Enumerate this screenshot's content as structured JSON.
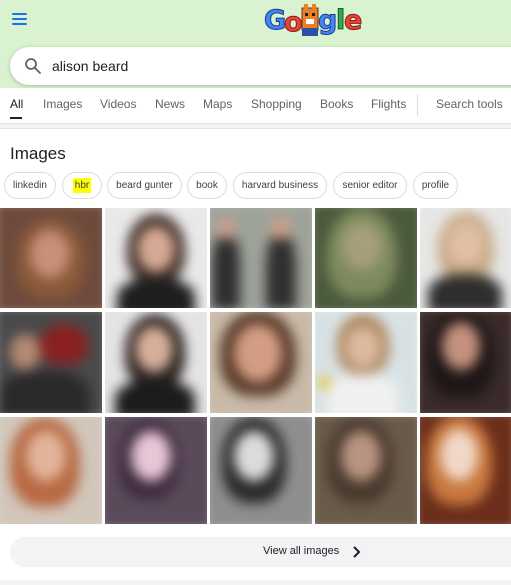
{
  "header": {
    "menu_icon": "hamburger-menu-icon",
    "logo_icon": "google-doodle-logo",
    "logo_letters": [
      "G",
      "o",
      "o",
      "g",
      "l",
      "e"
    ]
  },
  "search": {
    "query": "alison beard",
    "icon": "search-icon"
  },
  "tabs": [
    {
      "label": "All",
      "active": true
    },
    {
      "label": "Images"
    },
    {
      "label": "Videos"
    },
    {
      "label": "News"
    },
    {
      "label": "Maps"
    },
    {
      "label": "Shopping"
    },
    {
      "label": "Books"
    },
    {
      "label": "Flights"
    },
    {
      "label": "Search tools"
    }
  ],
  "images_section": {
    "title": "Images",
    "chips": [
      {
        "label": "linkedin"
      },
      {
        "label": "hbr",
        "highlighted": true
      },
      {
        "label": "beard gunter"
      },
      {
        "label": "book"
      },
      {
        "label": "harvard business"
      },
      {
        "label": "senior editor"
      },
      {
        "label": "profile"
      }
    ],
    "view_all_label": "View all images",
    "highlight_color": "#ffff00"
  },
  "colors": {
    "top_background": "#d9f2cf",
    "accent_blue": "#1a73e8",
    "text_primary": "#202124",
    "text_secondary": "#5f6368"
  }
}
